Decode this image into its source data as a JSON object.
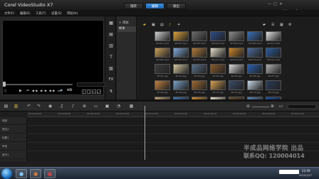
{
  "window": {
    "title": "Corel VideoStudio X7",
    "min_label": "—",
    "max_label": "□",
    "close_label": "✕"
  },
  "mode_tabs": [
    {
      "label": "捕获",
      "active": false
    },
    {
      "label": "编辑",
      "active": true
    },
    {
      "label": "输出",
      "active": false
    }
  ],
  "menu": [
    "文件(F)",
    "编辑(E)",
    "工具(T)",
    "设置(S)",
    "帮助(H)"
  ],
  "preview": {
    "play_label": "▶",
    "controls": "⏮ ◀◀ ◀ ▶ ▶▶ ⏭",
    "hd_label": "HD"
  },
  "library": {
    "add_label": "+ 添加",
    "folder_label": "样本",
    "media_filter_icons": [
      "folder-icon",
      "video-icon",
      "photo-icon",
      "audio-icon",
      "star-icon"
    ],
    "thumbnails": [
      {
        "label": "SP-V01.mp4",
        "color": "#cfcfcf"
      },
      {
        "label": "SP-V02.mp4",
        "color": "#d9a03a"
      },
      {
        "label": "SP-V03.mp4",
        "color": "#6b6b6b"
      },
      {
        "label": "SP-V04.wmv",
        "color": "#2d4a86"
      },
      {
        "label": "SP-V05.mp4",
        "color": "#8a8a8a"
      },
      {
        "label": "SP-V06.mp4",
        "color": "#3a6fb8"
      },
      {
        "label": "SP-V07.mp4",
        "color": "#e0e0e0"
      },
      {
        "label": "SP-V08.mp4",
        "color": "#caa05a"
      },
      {
        "label": "SP-V09.wmv",
        "color": "#7fa8d8"
      },
      {
        "label": "SP-V10.mp4",
        "color": "#b07a3a"
      },
      {
        "label": "SP-V11.mp4",
        "color": "#e3dcc8"
      },
      {
        "label": "SP-V12.mp4",
        "color": "#c8842a"
      },
      {
        "label": "SP-V13.wmv",
        "color": "#4a6a9a"
      },
      {
        "label": "SP-V14.mp4",
        "color": "#2a5a9a"
      },
      {
        "label": "SP-I01.jpg",
        "color": "#3e3e3e"
      },
      {
        "label": "SP-I02.jpg",
        "color": "#d4c8a0"
      },
      {
        "label": "SP-I03.jpg",
        "color": "#5a6f8a"
      },
      {
        "label": "SP-I04.jpg",
        "color": "#8a5a2a"
      },
      {
        "label": "SP-I05.jpg",
        "color": "#d8d8d8"
      },
      {
        "label": "SP-I06.jpg",
        "color": "#2b5fb0"
      },
      {
        "label": "SP-I07.jpg",
        "color": "#b0b0b0"
      },
      {
        "label": "SP-I08.jpg",
        "color": "#c08040"
      },
      {
        "label": "SP-I09.jpg",
        "color": "#7aa0c8"
      },
      {
        "label": "SP-I10.jpg",
        "color": "#a06a30"
      },
      {
        "label": "SP-I11.jpg",
        "color": "#d6a050"
      },
      {
        "label": "SP-I12.jpg",
        "color": "#3a4a6a"
      },
      {
        "label": "SP-I13.jpg",
        "color": "#c8d8e8"
      },
      {
        "label": "SP-I14.jpg",
        "color": "#2a3a5a"
      },
      {
        "label": "SP-I15.jpg",
        "color": "#c0a070"
      },
      {
        "label": "SP-I16.jpg",
        "color": "#4070b0"
      },
      {
        "label": "SP-I17.jpg",
        "color": "#d08a30"
      },
      {
        "label": "SP-I18.jpg",
        "color": "#e8e0c8"
      },
      {
        "label": "SP-I19.jpg",
        "color": "#6a4a2a"
      },
      {
        "label": "SP-I20.jpg",
        "color": "#5a80b8"
      },
      {
        "label": "SP-I21.jpg",
        "color": "#1a4a9a"
      }
    ]
  },
  "timeline": {
    "ruler_ticks": [
      "00:00:00:00",
      "00:00:06:00",
      "00:00:12:00",
      "00:00:18:00",
      "00:00:24:00",
      "00:00:30:00",
      "00:00:36:00",
      "00:00:42:00",
      "00:00:48:00",
      "00:00:54:00"
    ],
    "tracks": [
      "视频",
      "叠加1",
      "标题1",
      "声音",
      "音乐1"
    ]
  },
  "watermarks": {
    "logo": "优酷",
    "line1": "半成品网络学院 出品",
    "line2": "联系QQ: 120004014"
  },
  "taskbar": {
    "apps": [
      "●",
      "◉",
      "▣"
    ],
    "time": "22:09",
    "date": "2015/1/27"
  }
}
